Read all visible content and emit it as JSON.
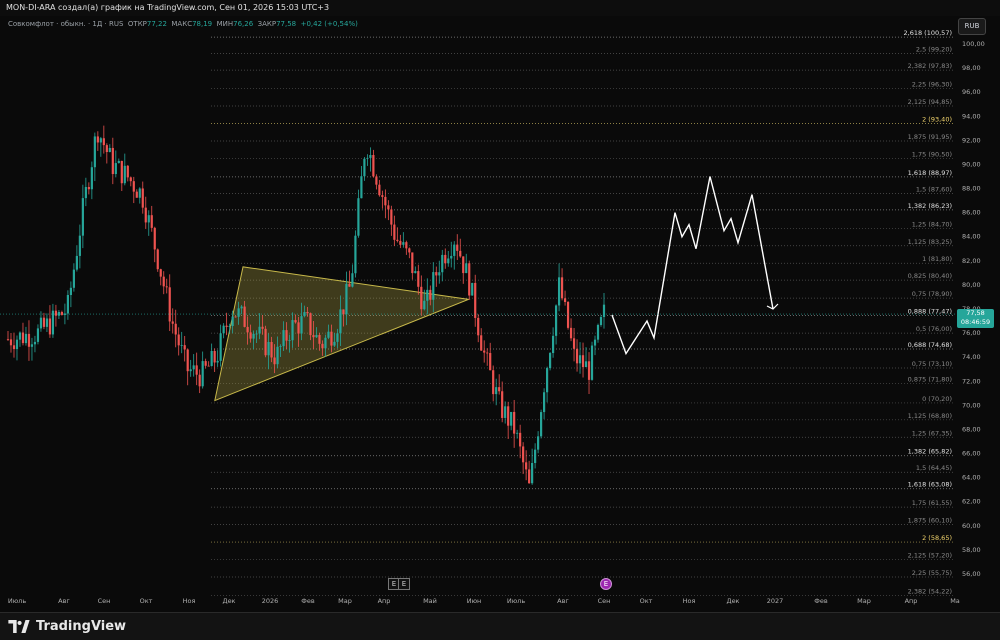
{
  "topbar": {
    "caption": "MON-DI-ARA создал(а) график на TradingView.com, Сен 01, 2026 15:03 UTC+3"
  },
  "legend": {
    "symbol": "Совкомфлот · обыкн. · 1Д · RUS",
    "open_label": "ОТКР",
    "open": "77,22",
    "high_label": "МАКС",
    "high": "78,19",
    "low_label": "МИН",
    "low": "76,26",
    "close_label": "ЗАКР",
    "close": "77,58",
    "change": "+0,42 (+0,54%)"
  },
  "currency_button": "RUB",
  "last_price": {
    "price": "77,58",
    "countdown": "08:46:59"
  },
  "y_ticks": [
    "100,00",
    "98,00",
    "96,00",
    "94,00",
    "92,00",
    "90,00",
    "88,00",
    "86,00",
    "84,00",
    "82,00",
    "80,00",
    "78,00",
    "76,00",
    "74,00",
    "72,00",
    "70,00",
    "68,00",
    "66,00",
    "64,00",
    "62,00",
    "60,00",
    "58,00",
    "56,00"
  ],
  "x_ticks": [
    "Июль",
    "Авг",
    "Сен",
    "Окт",
    "Ноя",
    "Дек",
    "2026",
    "Фев",
    "Мар",
    "Апр",
    "Май",
    "Июн",
    "Июль",
    "Авг",
    "Сен",
    "Окт",
    "Ноя",
    "Дек",
    "2027",
    "Фев",
    "Мар",
    "Апр",
    "Ма"
  ],
  "fib_levels": [
    {
      "label": "2,618 (100,57)",
      "price": 100.57,
      "major": true
    },
    {
      "label": "2,5 (99,20)",
      "price": 99.2,
      "major": false
    },
    {
      "label": "2,382 (97,83)",
      "price": 97.83,
      "major": false
    },
    {
      "label": "2,25 (96,30)",
      "price": 96.3,
      "major": false
    },
    {
      "label": "2,125 (94,85)",
      "price": 94.85,
      "major": false
    },
    {
      "label": "2 (93,40)",
      "price": 93.4,
      "major": true,
      "yellow": true
    },
    {
      "label": "1,875 (91,95)",
      "price": 91.95,
      "major": false
    },
    {
      "label": "1,75 (90,50)",
      "price": 90.5,
      "major": false
    },
    {
      "label": "1,618 (88,97)",
      "price": 88.97,
      "major": true
    },
    {
      "label": "1,5 (87,60)",
      "price": 87.6,
      "major": false
    },
    {
      "label": "1,382 (86,23)",
      "price": 86.23,
      "major": true
    },
    {
      "label": "1,25 (84,70)",
      "price": 84.7,
      "major": false
    },
    {
      "label": "1,125 (83,25)",
      "price": 83.25,
      "major": false
    },
    {
      "label": "1 (81,80)",
      "price": 81.8,
      "major": false
    },
    {
      "label": "0,825 (80,40)",
      "price": 80.4,
      "major": false
    },
    {
      "label": "0,75 (78,90)",
      "price": 78.9,
      "major": false
    },
    {
      "label": "0,888 (77,47)",
      "price": 77.47,
      "major": true
    },
    {
      "label": "0,5 (76,00)",
      "price": 76.0,
      "major": false
    },
    {
      "label": "0,688 (74,68)",
      "price": 74.68,
      "major": true
    },
    {
      "label": "0,75 (73,10)",
      "price": 73.1,
      "major": false
    },
    {
      "label": "0,875 (71,80)",
      "price": 71.8,
      "major": false
    },
    {
      "label": "0 (70,20)",
      "price": 70.2,
      "major": false
    },
    {
      "label": "1,125 (68,80)",
      "price": 68.8,
      "major": false
    },
    {
      "label": "1,25 (67,35)",
      "price": 67.35,
      "major": false
    },
    {
      "label": "1,382 (65,82)",
      "price": 65.82,
      "major": true
    },
    {
      "label": "1,5 (64,45)",
      "price": 64.45,
      "major": false
    },
    {
      "label": "1,618 (63,08)",
      "price": 63.08,
      "major": true
    },
    {
      "label": "1,75 (61,55)",
      "price": 61.55,
      "major": false
    },
    {
      "label": "1,875 (60,10)",
      "price": 60.1,
      "major": false
    },
    {
      "label": "2 (58,65)",
      "price": 58.65,
      "major": true,
      "yellow": true
    },
    {
      "label": "2,125 (57,20)",
      "price": 57.2,
      "major": false
    },
    {
      "label": "2,25 (55,75)",
      "price": 55.75,
      "major": false
    },
    {
      "label": "2,382 (54,22)",
      "price": 54.22,
      "major": false
    }
  ],
  "event_buttons": [
    "E",
    "E",
    "E"
  ],
  "brand": {
    "name": "TradingView"
  },
  "colors": {
    "up": "#26a69a",
    "down": "#ef5350",
    "triangle": "#c8b94a",
    "projection": "#ffffff",
    "last_price": "#26a69a",
    "fib_yellow": "#f5d76e"
  },
  "chart_data": {
    "type": "candlestick",
    "series_path_close": [
      [
        0,
        75.5
      ],
      [
        2,
        76.0
      ],
      [
        4,
        78.0
      ],
      [
        5,
        86.0
      ],
      [
        6,
        93.0
      ],
      [
        7,
        90.0
      ],
      [
        8,
        89.0
      ],
      [
        9,
        87.5
      ],
      [
        10,
        82.5
      ],
      [
        11,
        77.0
      ],
      [
        12,
        73.0
      ],
      [
        13,
        72.5
      ],
      [
        14,
        74.0
      ],
      [
        15,
        78.0
      ],
      [
        16,
        77.0
      ],
      [
        17,
        75.5
      ],
      [
        18,
        74.0
      ],
      [
        19,
        76.5
      ],
      [
        20,
        77.0
      ],
      [
        21,
        75.0
      ],
      [
        22,
        76.5
      ],
      [
        23,
        80.0
      ],
      [
        24,
        92.0
      ],
      [
        25,
        88.0
      ],
      [
        26,
        84.0
      ],
      [
        27,
        82.0
      ],
      [
        28,
        78.0
      ],
      [
        29,
        82.0
      ],
      [
        30,
        84.0
      ],
      [
        31,
        80.0
      ],
      [
        32,
        74.0
      ],
      [
        33,
        70.0
      ],
      [
        34,
        68.0
      ],
      [
        35,
        63.0
      ],
      [
        36,
        72.0
      ],
      [
        37,
        80.0
      ],
      [
        38,
        74.0
      ],
      [
        39,
        73.0
      ],
      [
        40,
        77.6
      ]
    ],
    "triangle": [
      [
        0.22,
        70.4
      ],
      [
        0.25,
        81.5
      ],
      [
        0.49,
        78.8
      ]
    ],
    "projection": [
      [
        0.0,
        77.5
      ],
      [
        0.02,
        74.3
      ],
      [
        0.05,
        77.0
      ],
      [
        0.06,
        75.6
      ],
      [
        0.09,
        86.0
      ],
      [
        0.1,
        84.0
      ],
      [
        0.11,
        85.0
      ],
      [
        0.12,
        83.0
      ],
      [
        0.14,
        89.0
      ],
      [
        0.16,
        84.5
      ],
      [
        0.17,
        85.5
      ],
      [
        0.18,
        83.5
      ],
      [
        0.2,
        87.5
      ],
      [
        0.23,
        78.0
      ]
    ]
  }
}
